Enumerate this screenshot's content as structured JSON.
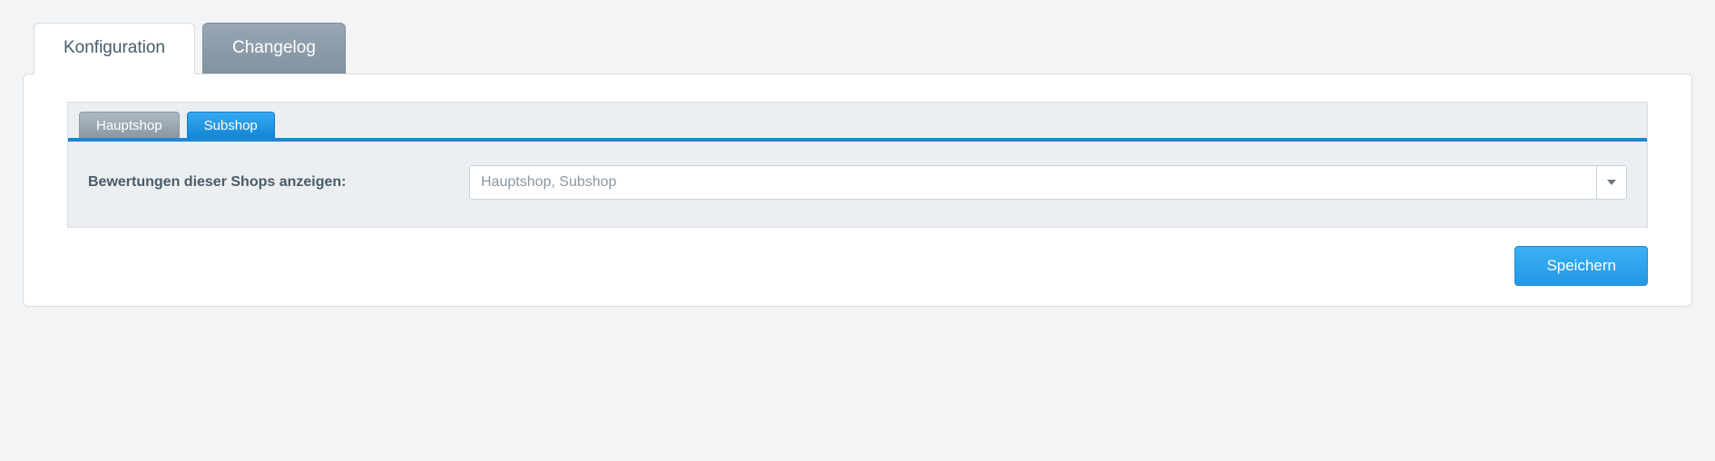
{
  "outer_tabs": {
    "active": "Konfiguration",
    "inactive": "Changelog"
  },
  "inner_tabs": {
    "inactive": "Hauptshop",
    "active": "Subshop"
  },
  "form": {
    "label": "Bewertungen dieser Shops anzeigen:",
    "select_value": "Hauptshop, Subshop"
  },
  "buttons": {
    "save": "Speichern"
  }
}
